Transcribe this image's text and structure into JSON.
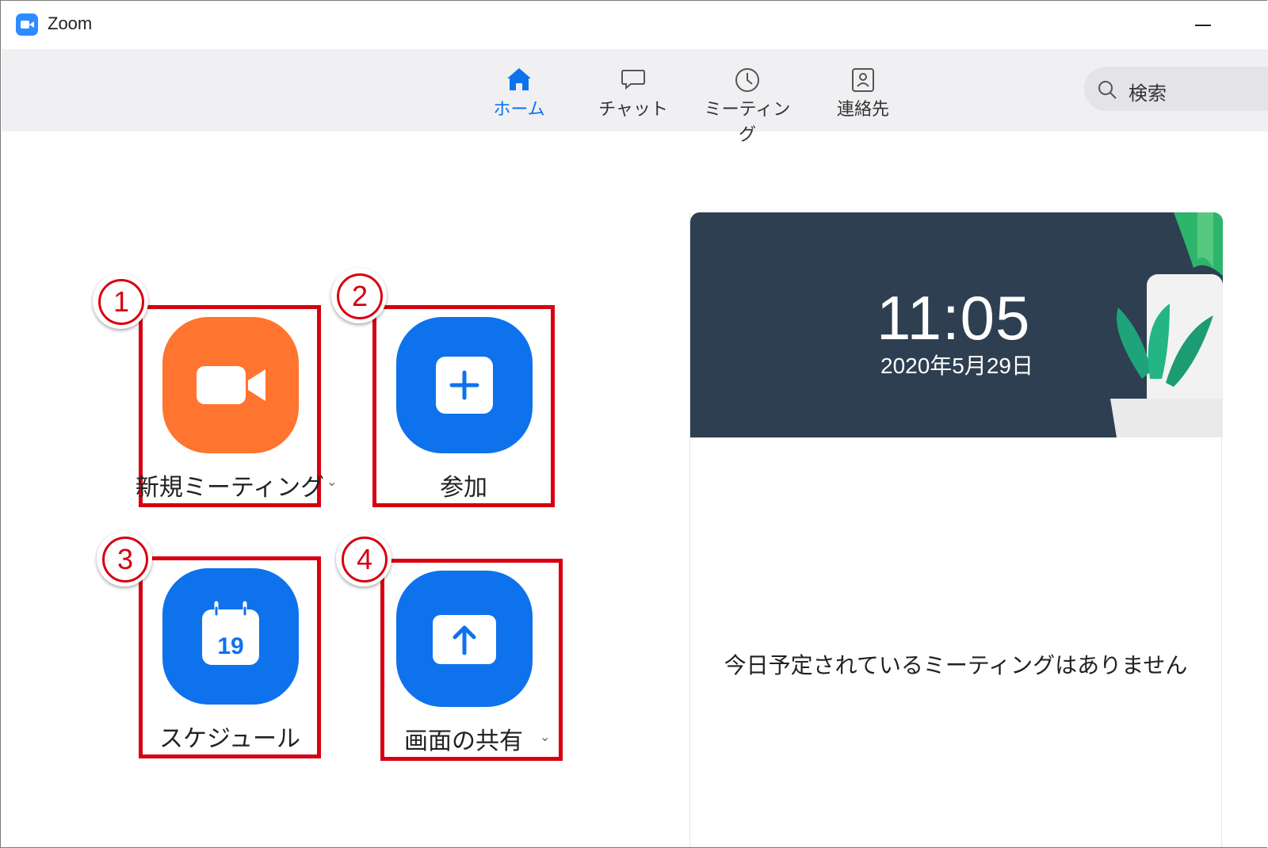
{
  "window": {
    "title": "Zoom"
  },
  "nav": {
    "tabs": [
      {
        "label": "ホーム",
        "icon": "home-icon",
        "active": true
      },
      {
        "label": "チャット",
        "icon": "chat-icon",
        "active": false
      },
      {
        "label": "ミーティング",
        "icon": "clock-icon",
        "active": false
      },
      {
        "label": "連絡先",
        "icon": "contact-icon",
        "active": false
      }
    ],
    "search": {
      "placeholder": "検索",
      "icon": "search-icon"
    }
  },
  "actions": [
    {
      "number": "1",
      "label": "新規ミーティング",
      "icon": "video-camera-icon",
      "color": "#ff742e",
      "has_dropdown": true
    },
    {
      "number": "2",
      "label": "参加",
      "icon": "plus-icon",
      "color": "#0e72ed",
      "has_dropdown": false
    },
    {
      "number": "3",
      "label": "スケジュール",
      "icon": "calendar-icon",
      "icon_text": "19",
      "color": "#0e72ed",
      "has_dropdown": false
    },
    {
      "number": "4",
      "label": "画面の共有",
      "icon": "share-screen-icon",
      "color": "#0e72ed",
      "has_dropdown": true
    }
  ],
  "panel": {
    "time": "11:05",
    "date": "2020年5月29日",
    "empty_message": "今日予定されているミーティングはありません"
  },
  "colors": {
    "accent": "#0e72ed",
    "new_meeting": "#ff742e",
    "highlight": "#d7000f",
    "header_bg": "#2f3f52"
  }
}
